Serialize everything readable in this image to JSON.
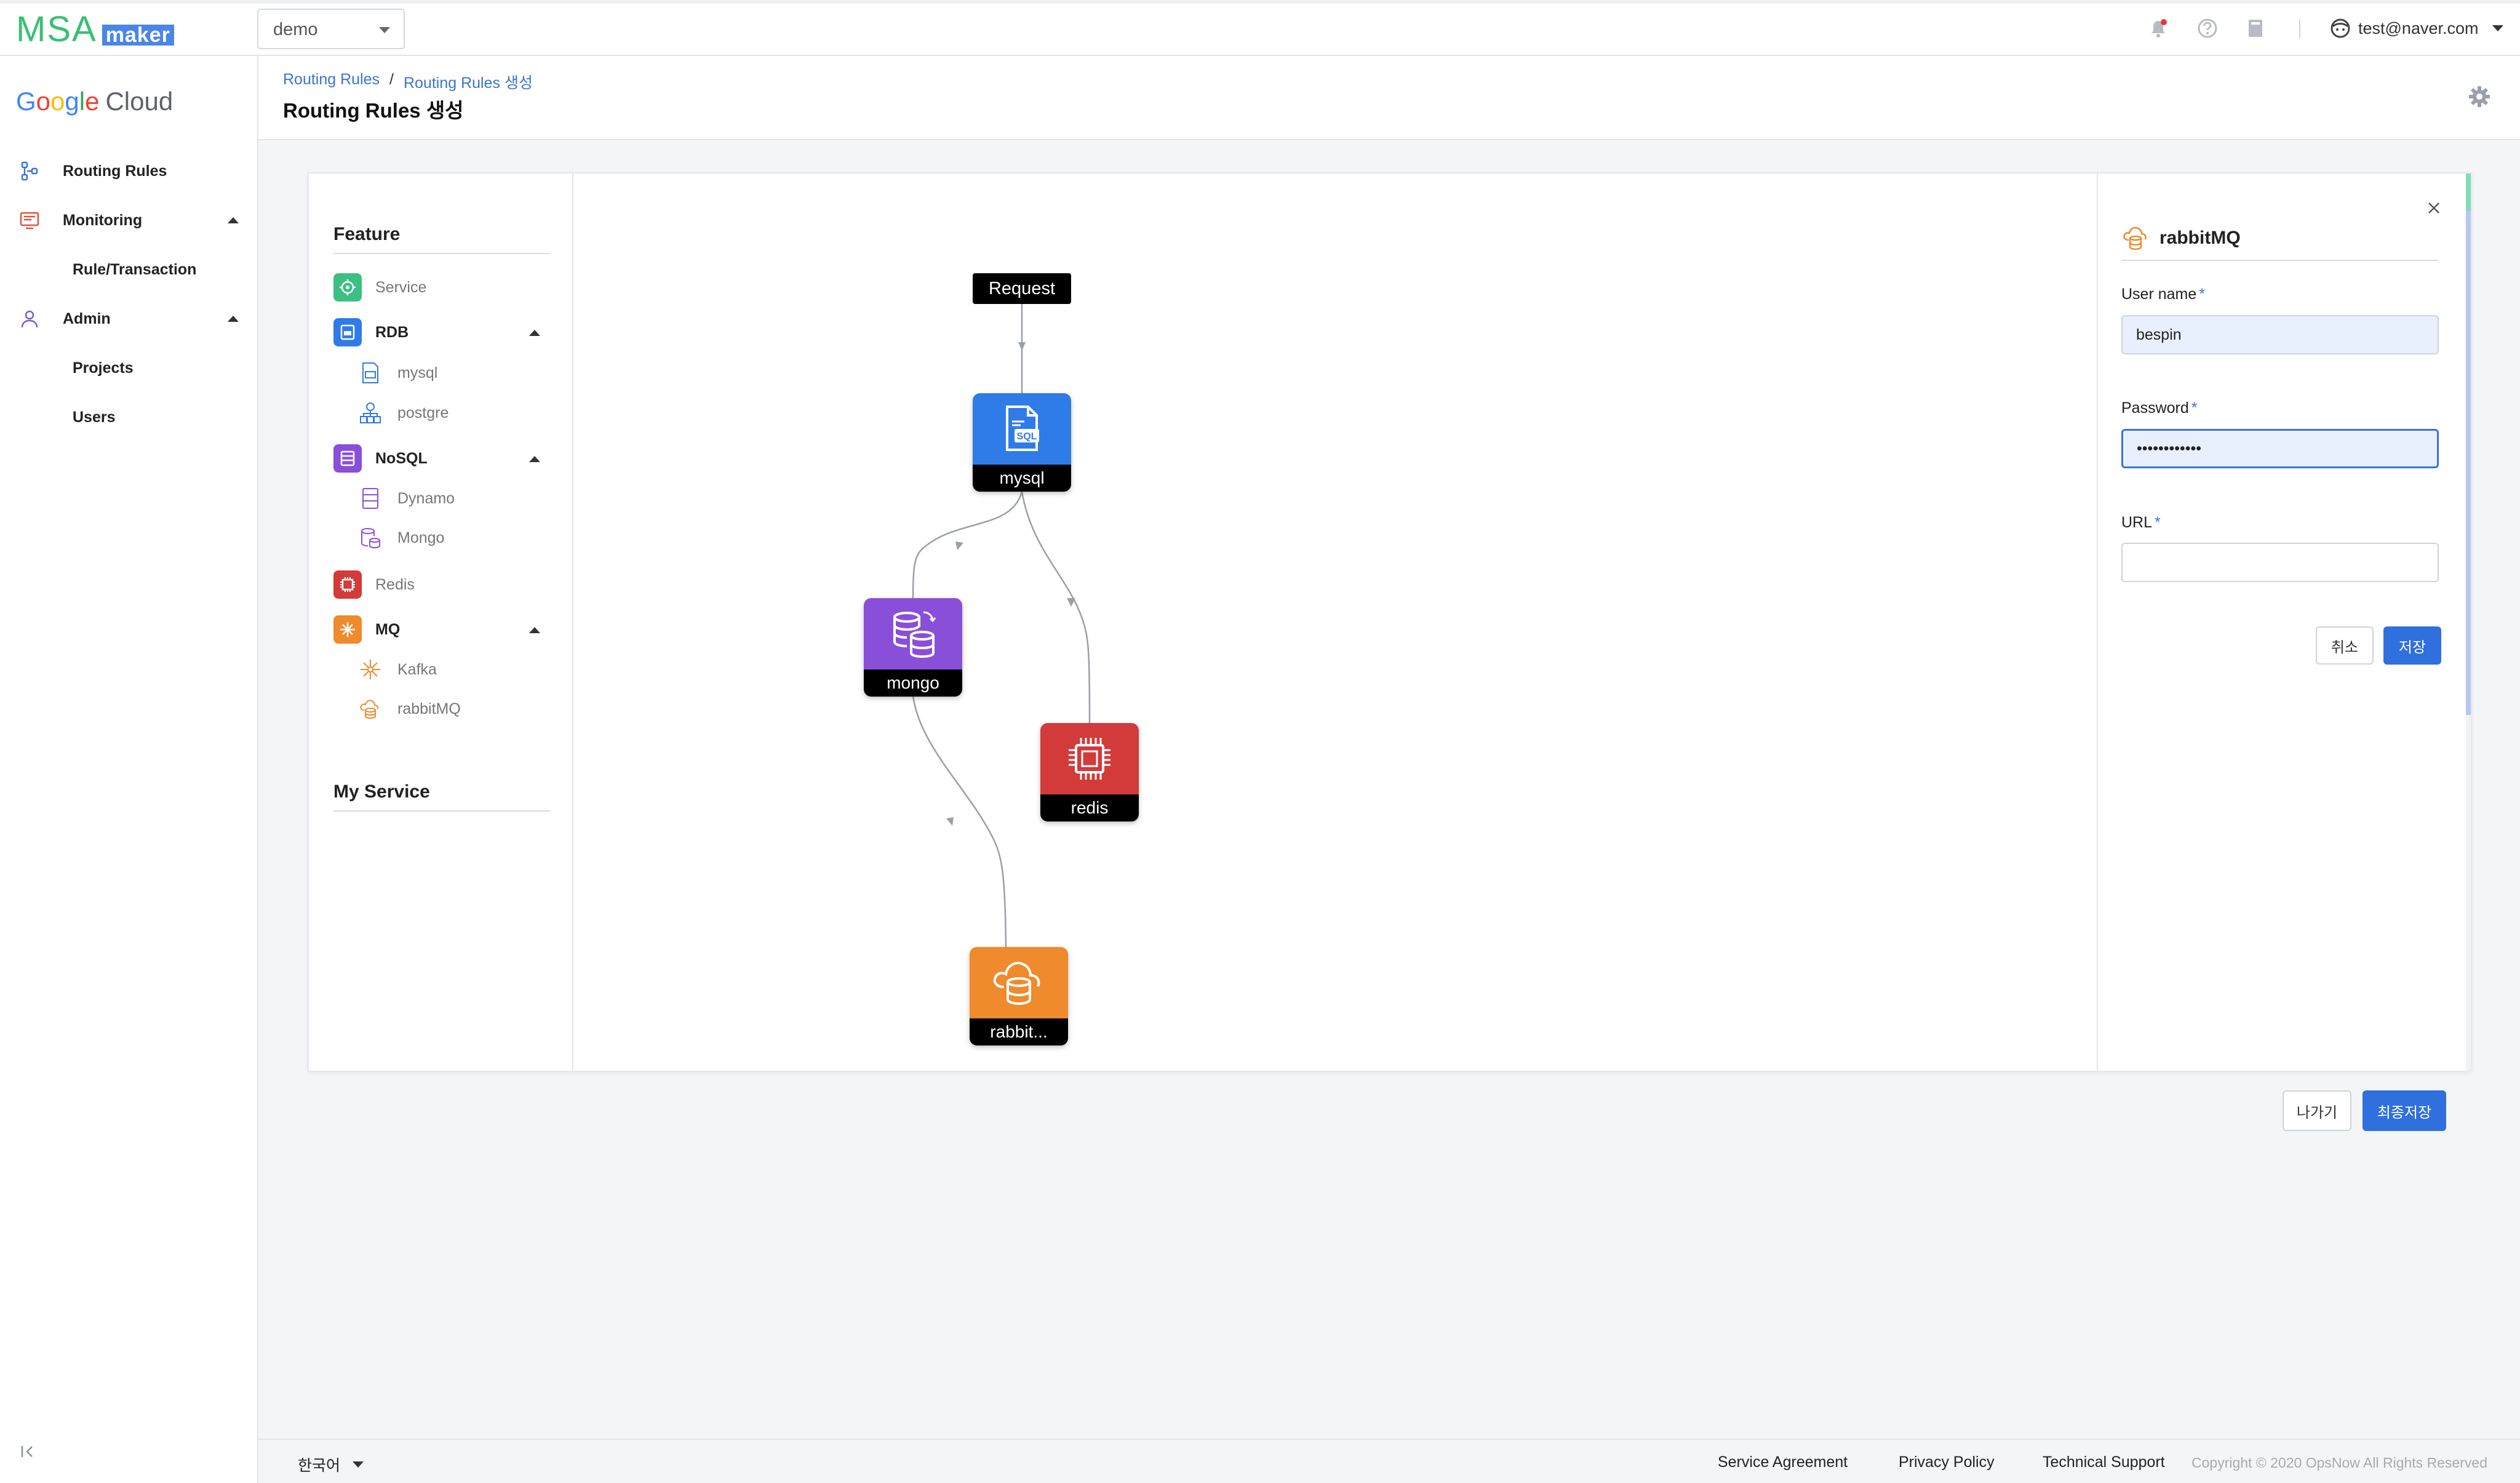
{
  "app": {
    "logo_main": "MSA",
    "logo_sub": "maker",
    "project": "demo",
    "user_email": "test@naver.com",
    "icons": [
      "bell-icon",
      "help-icon",
      "book-icon",
      "user-avatar-icon"
    ],
    "colors": {
      "brand_green": "#38c172",
      "primary_blue": "#2f6fde",
      "link_blue": "#3b73d6"
    }
  },
  "sidebar": {
    "brand": {
      "letters": [
        "G",
        "o",
        "o",
        "g",
        "l",
        "e"
      ],
      "suffix": "Cloud"
    },
    "items": [
      {
        "label": "Routing Rules",
        "icon": "routing-icon"
      },
      {
        "label": "Monitoring",
        "icon": "monitor-icon",
        "expanded": true
      },
      {
        "label": "Rule/Transaction"
      },
      {
        "label": "Admin",
        "icon": "admin-icon",
        "expanded": true
      },
      {
        "label": "Projects"
      },
      {
        "label": "Users"
      }
    ]
  },
  "header": {
    "breadcrumb": [
      "Routing Rules",
      "Routing Rules 생성"
    ],
    "separator": "/",
    "title": "Routing Rules 생성"
  },
  "feature": {
    "title": "Feature",
    "items": {
      "service": "Service",
      "rdb": "RDB",
      "mysql": "mysql",
      "postgre": "postgre",
      "nosql": "NoSQL",
      "dynamo": "Dynamo",
      "mongo": "Mongo",
      "redis": "Redis",
      "mq": "MQ",
      "kafka": "Kafka",
      "rabbitmq": "rabbitMQ"
    },
    "colors": {
      "service": "#3cbf83",
      "rdb": "#2f7be8",
      "nosql": "#8a4fd8",
      "redis": "#d33a3a",
      "mq": "#ef8a2d"
    },
    "my_service_title": "My Service"
  },
  "canvas": {
    "request_label": "Request",
    "nodes": {
      "mysql": "mysql",
      "mongo": "mongo",
      "redis": "redis",
      "rabbit": "rabbit..."
    }
  },
  "props": {
    "title": "rabbitMQ",
    "user_label": "User name",
    "user_value": "bespin",
    "password_label": "Password",
    "password_value": "bespinbespin",
    "url_label": "URL",
    "url_value": "",
    "required_mark": "*",
    "cancel": "취소",
    "save": "저장"
  },
  "actions": {
    "exit": "나가기",
    "final_save": "최종저장"
  },
  "footer": {
    "language": "한국어",
    "links": [
      "Service Agreement",
      "Privacy Policy",
      "Technical Support"
    ],
    "copyright": "Copyright © 2020 OpsNow All Rights Reserved"
  }
}
